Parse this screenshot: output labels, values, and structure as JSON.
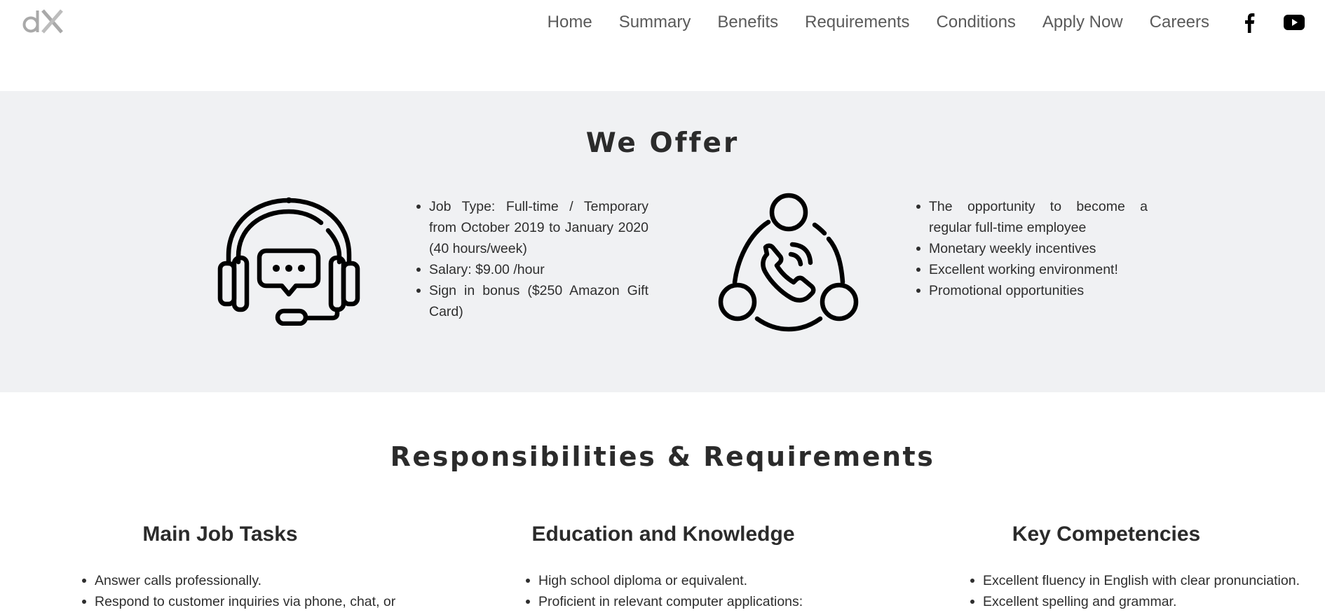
{
  "header": {
    "logo_text": "dX",
    "nav": [
      {
        "label": "Home"
      },
      {
        "label": "Summary"
      },
      {
        "label": "Benefits"
      },
      {
        "label": "Requirements"
      },
      {
        "label": "Conditions"
      },
      {
        "label": "Apply Now"
      },
      {
        "label": "Careers"
      }
    ],
    "social": {
      "facebook_icon": "facebook-icon",
      "youtube_icon": "youtube-icon"
    }
  },
  "offer": {
    "title": "We Offer",
    "left_icon": "headset-chat-icon",
    "right_icon": "network-phone-icon",
    "left_items": [
      "Job Type: Full-time / Temporary from October 2019 to January 2020 (40 hours/week)",
      "Salary: $9.00 /hour",
      "Sign in bonus ($250 Amazon Gift Card)"
    ],
    "right_items": [
      "The opportunity to become a regular full-time employee",
      "Monetary weekly incentives",
      "Excellent working environment!",
      "Promotional opportunities"
    ]
  },
  "responsibilities": {
    "title": "Responsibilities & Requirements",
    "columns": [
      {
        "heading": "Main Job Tasks",
        "items": [
          "Answer calls professionally.",
          "Respond to customer inquiries via phone, chat, or"
        ]
      },
      {
        "heading": "Education and Knowledge",
        "items": [
          "High school diploma or equivalent.",
          "Proficient in relevant computer applications:"
        ]
      },
      {
        "heading": "Key Competencies",
        "items": [
          "Excellent fluency in English with clear pronunciation.",
          "Excellent spelling and grammar."
        ]
      }
    ]
  }
}
